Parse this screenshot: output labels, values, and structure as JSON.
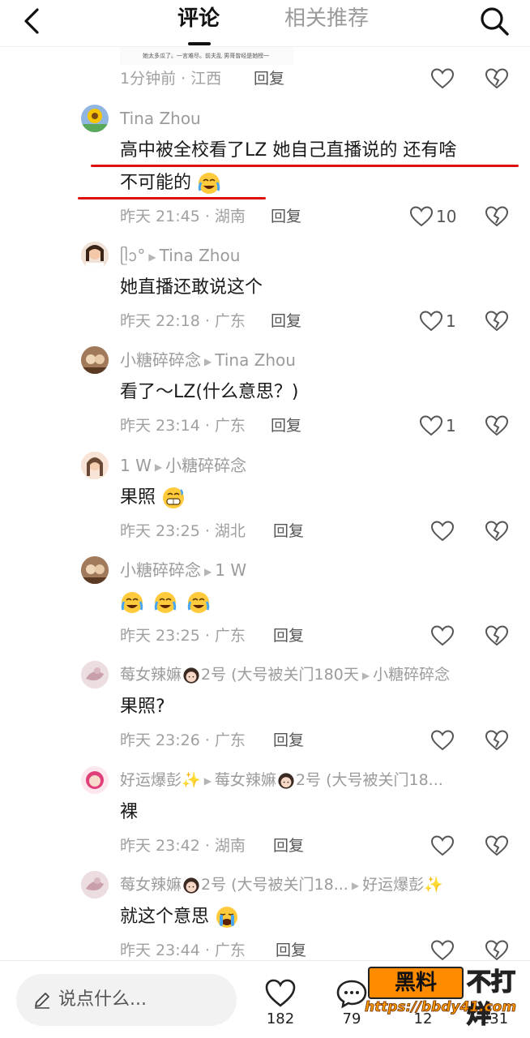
{
  "header": {
    "tab_comments": "评论",
    "tab_related": "相关推荐"
  },
  "partial": {
    "image_text": "她太多瓜了。一言难尽。前夫乱 男哥曾经是她榜一",
    "time": "1分钟前 · 江西",
    "reply": "回复"
  },
  "comments": [
    {
      "author": "Tina Zhou",
      "reply_to": "",
      "text_line1": "高中被全校看了LZ 她自己直播说的 还有啥",
      "text_line2": "不可能的",
      "time": "昨天 21:45 · 湖南",
      "reply": "回复",
      "likes": "10"
    },
    {
      "author": "ᥫᩣ°",
      "reply_to": "Tina Zhou",
      "text": "她直播还敢说这个",
      "time": "昨天 22:18 · 广东",
      "reply": "回复",
      "likes": "1"
    },
    {
      "author": "小糖碎碎念",
      "reply_to": "Tina Zhou",
      "text": "看了～LZ(什么意思？)",
      "time": "昨天 23:14 · 广东",
      "reply": "回复",
      "likes": "1"
    },
    {
      "author": "1 W",
      "reply_to": "小糖碎碎念",
      "text": "果照",
      "time": "昨天 23:25 · 湖北",
      "reply": "回复",
      "likes": ""
    },
    {
      "author": "小糖碎碎念",
      "reply_to": "1 W",
      "text": "",
      "time": "昨天 23:25 · 广东",
      "reply": "回复",
      "likes": ""
    },
    {
      "author": "莓女辣嫲",
      "author_suffix": "2号 (大号被关门180天",
      "reply_to": "小糖碎碎念",
      "text": "果照?",
      "time": "昨天 23:26 · 广东",
      "reply": "回复",
      "likes": ""
    },
    {
      "author": "好运爆彭",
      "reply_to": "莓女辣嫲",
      "reply_suffix": "2号 (大号被关门18...",
      "text": "裸",
      "time": "昨天 23:42 · 湖南",
      "reply": "回复",
      "likes": ""
    },
    {
      "author": "莓女辣嫲",
      "author_suffix": "2号 (大号被关门18...",
      "reply_to": "好运爆彭",
      "text": "就这个意思",
      "time": "昨天 23:44 · 广东",
      "reply": "回复",
      "likes": ""
    }
  ],
  "bottom": {
    "placeholder": "说点什么...",
    "likes": "182",
    "comments": "79",
    "collect": "12",
    "share": "231"
  },
  "watermark": {
    "brand": "黑料",
    "side": "不打烊",
    "url": "https://bbdy41.com"
  },
  "colors": {
    "annotation": "#e01010",
    "watermark": "#ff8c00"
  }
}
